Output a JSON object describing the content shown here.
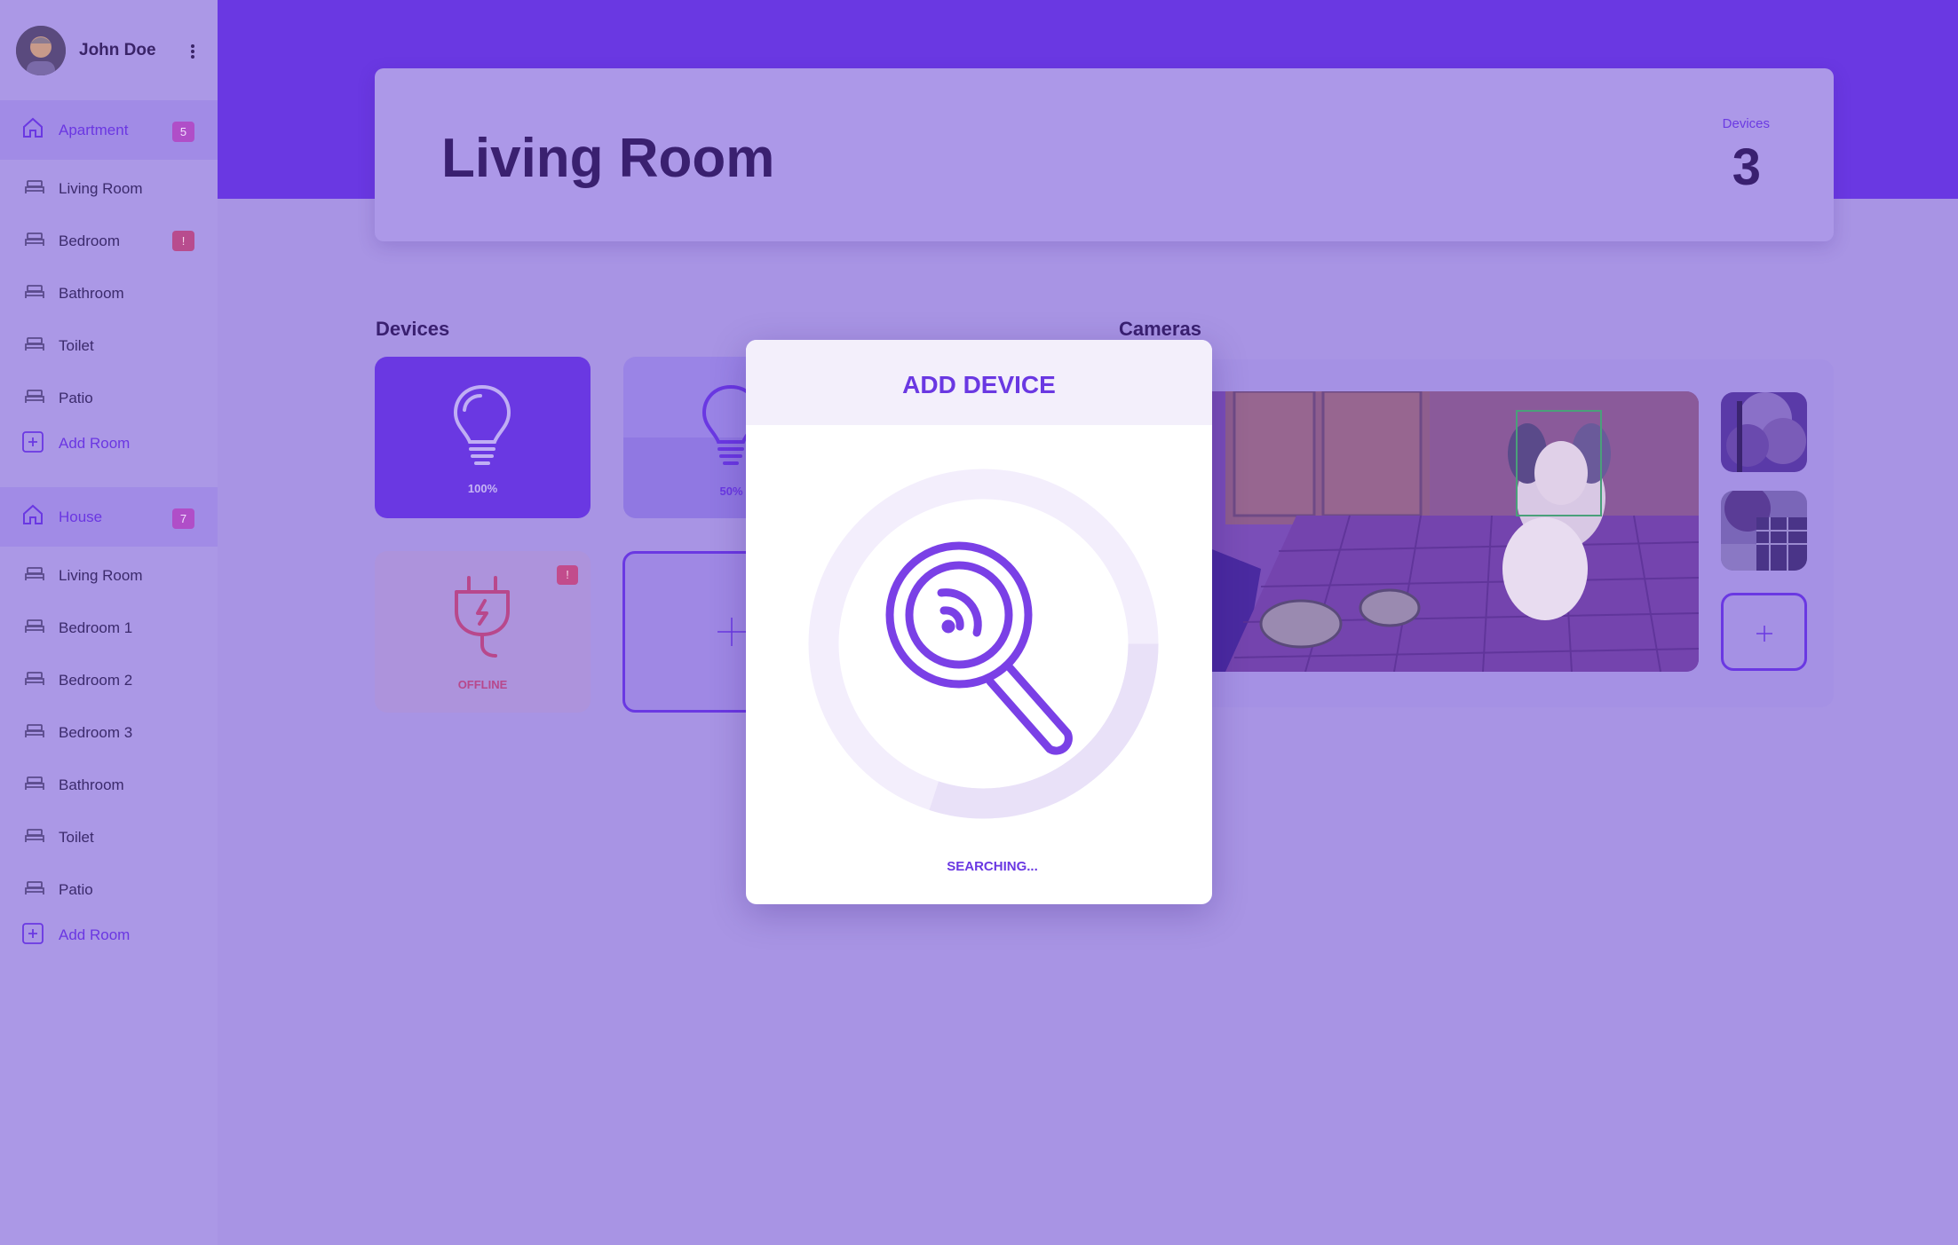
{
  "user": {
    "name": "John Doe"
  },
  "sidebar": {
    "groups": [
      {
        "label": "Apartment",
        "badge": "5",
        "items": [
          {
            "label": "Living Room",
            "badge": ""
          },
          {
            "label": "Bedroom",
            "badge": "!"
          },
          {
            "label": "Bathroom",
            "badge": ""
          },
          {
            "label": "Toilet",
            "badge": ""
          },
          {
            "label": "Patio",
            "badge": ""
          }
        ],
        "add_label": "Add Room"
      },
      {
        "label": "House",
        "badge": "7",
        "items": [
          {
            "label": "Living Room",
            "badge": ""
          },
          {
            "label": "Bedroom 1",
            "badge": ""
          },
          {
            "label": "Bedroom 2",
            "badge": ""
          },
          {
            "label": "Bedroom 3",
            "badge": ""
          },
          {
            "label": "Bathroom",
            "badge": ""
          },
          {
            "label": "Toilet",
            "badge": ""
          },
          {
            "label": "Patio",
            "badge": ""
          }
        ],
        "add_label": "Add Room"
      }
    ]
  },
  "header": {
    "room_title": "Living Room",
    "devices_label": "Devices",
    "devices_count": "3"
  },
  "devices": {
    "section_title": "Devices",
    "tiles": [
      {
        "icon": "lightbulb-icon",
        "label": "100%",
        "level": 1.0,
        "state": "on"
      },
      {
        "icon": "lightbulb-icon",
        "label": "50%",
        "level": 0.5,
        "state": "dimmed"
      },
      {
        "icon": "plug-icon",
        "label": "OFFLINE",
        "badge": "!",
        "state": "offline"
      }
    ],
    "add_icon": "plus-icon"
  },
  "cameras": {
    "section_title": "Cameras",
    "main_feed": "dog-camera-feed",
    "thumbnails": [
      "tree-camera-feed",
      "building-camera-feed"
    ],
    "add_icon": "plus-icon"
  },
  "modal": {
    "title": "ADD DEVICE",
    "status": "SEARCHING...",
    "icon": "search-signal-icon",
    "progress": 0.3
  },
  "colors": {
    "primary": "#6a38e2",
    "badge": "#b04ec8",
    "alert": "#c24c8c"
  }
}
